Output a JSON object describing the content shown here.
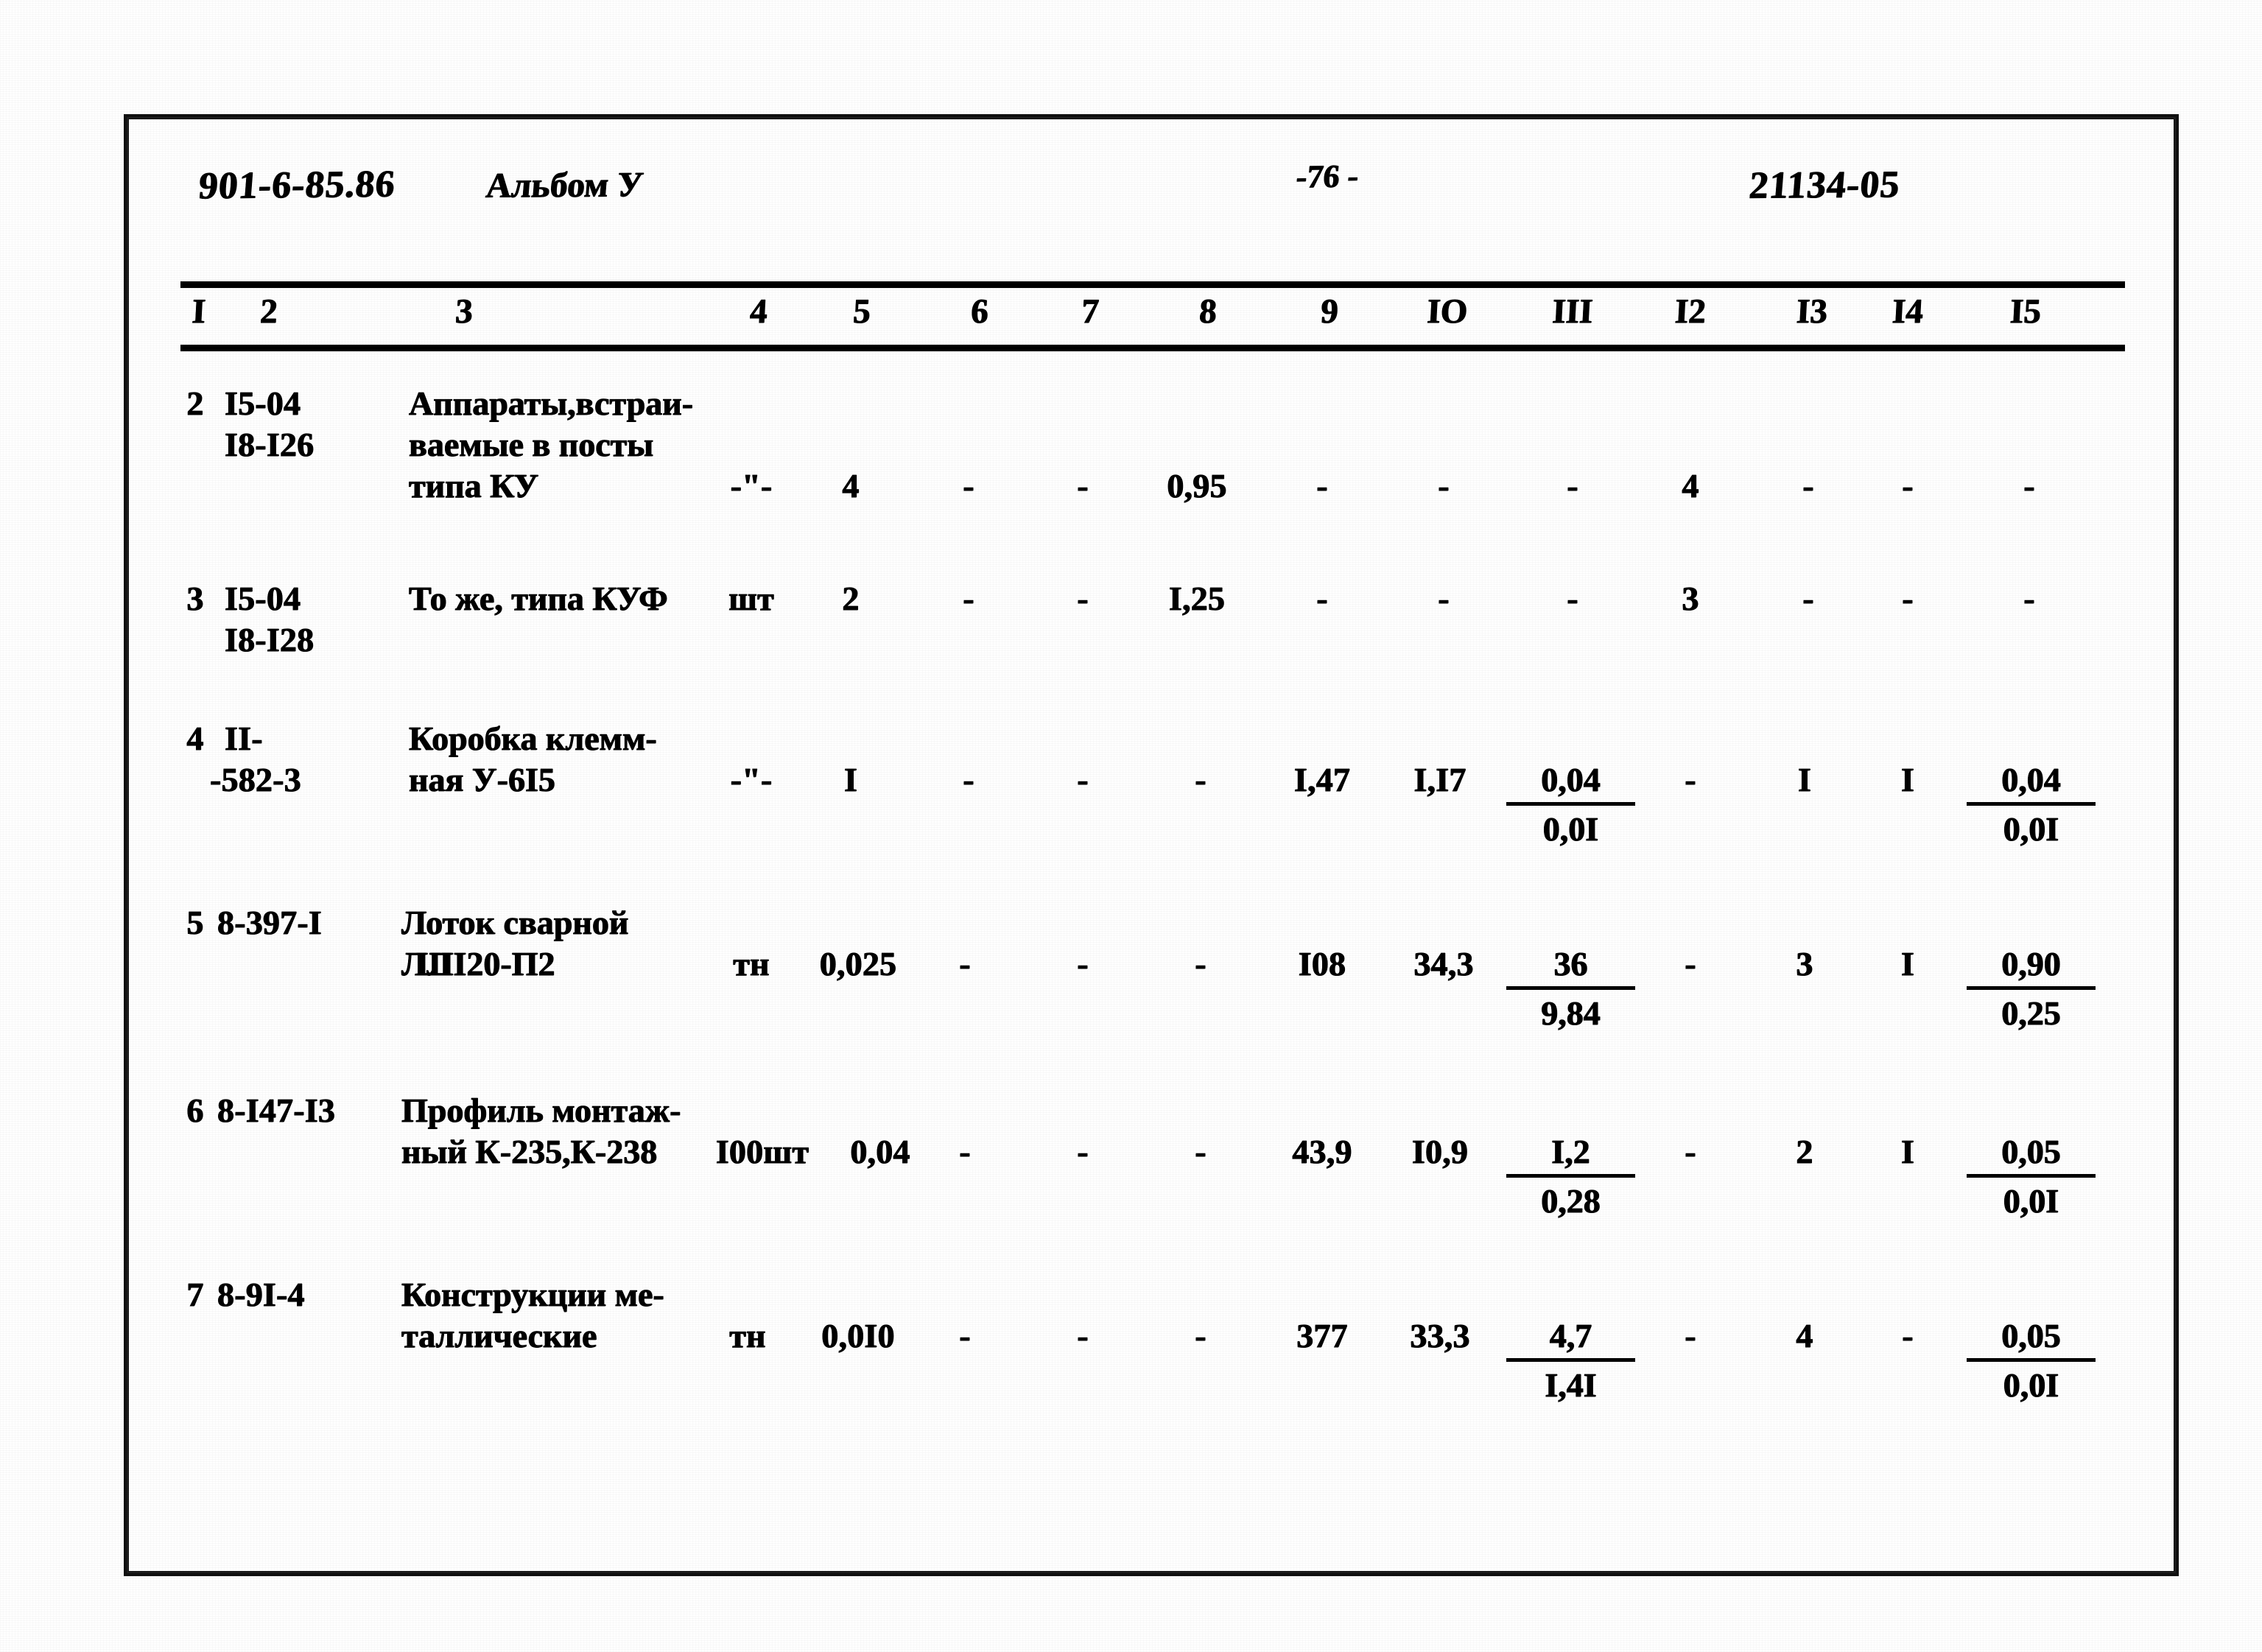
{
  "header": {
    "doc_code": "901-6-85.86",
    "album": "Альбом У",
    "page_number": "-76 -",
    "right_code": "21134-05"
  },
  "table": {
    "column_numbers": [
      "I",
      "2",
      "3",
      "4",
      "5",
      "6",
      "7",
      "8",
      "9",
      "IO",
      "III",
      "I2",
      "I3",
      "I4",
      "I5"
    ],
    "rows": [
      {
        "c1": "2",
        "c2_line1": "I5-04",
        "c2_line2": "I8-I26",
        "c3_line1": "Аппараты,встраи-",
        "c3_line2": "ваемые в посты",
        "c3_line3": "типа КУ",
        "c4": "-\"-",
        "c5": "4",
        "c6": "-",
        "c7": "-",
        "c8": "0,95",
        "c9": "-",
        "c10": "-",
        "c11": "-",
        "c12": "4",
        "c13": "-",
        "c14": "-",
        "c15": "-"
      },
      {
        "c1": "3",
        "c2_line1": "I5-04",
        "c2_line2": "I8-I28",
        "c3_line1": "То же, типа КУФ",
        "c3_line2": "",
        "c3_line3": "",
        "c4": "шт",
        "c5": "2",
        "c6": "-",
        "c7": "-",
        "c8": "I,25",
        "c9": "-",
        "c10": "-",
        "c11": "-",
        "c12": "3",
        "c13": "-",
        "c14": "-",
        "c15": "-"
      },
      {
        "c1": "4",
        "c2_line1": "II-",
        "c2_line2": "-582-3",
        "c3_line1": "Коробка клемм-",
        "c3_line2": "ная У-6I5",
        "c3_line3": "",
        "c4": "-\"-",
        "c5": "I",
        "c6": "-",
        "c7": "-",
        "c8": "-",
        "c9": "I,47",
        "c10": "I,I7",
        "c11_top": "0,04",
        "c11_bot": "0,0I",
        "c12": "-",
        "c13": "I",
        "c14": "I",
        "c15_top": "0,04",
        "c15_bot": "0,0I"
      },
      {
        "c1": "5",
        "c2_line1": "8-397-I",
        "c2_line2": "",
        "c3_line1": "Лоток сварной",
        "c3_line2": "ШI20-П2",
        "c3_line2_overstrike": "ЛЛ",
        "c3_line3": "",
        "c4": "тн",
        "c5": "0,025",
        "c6": "-",
        "c7": "-",
        "c8": "-",
        "c9": "I08",
        "c10": "34,3",
        "c11_top": "36",
        "c11_bot": "9,84",
        "c12": "-",
        "c13": "3",
        "c14": "I",
        "c15_top": "0,90",
        "c15_bot": "0,25"
      },
      {
        "c1": "6",
        "c2_line1": "8-I47-I3",
        "c2_line2": "",
        "c3_line1": "Профиль монтаж-",
        "c3_line2": "ный К-235,К-238",
        "c3_line3": "",
        "c4": "I00шт",
        "c5": "0,04",
        "c6": "-",
        "c7": "-",
        "c8": "-",
        "c9": "43,9",
        "c10": "I0,9",
        "c11_top": "I,2",
        "c11_bot": "0,28",
        "c12": "-",
        "c13": "2",
        "c14": "I",
        "c15_top": "0,05",
        "c15_bot": "0,0I"
      },
      {
        "c1": "7",
        "c2_line1": "8-9I-4",
        "c2_line2": "",
        "c3_line1": "Конструкции ме-",
        "c3_line2": "таллические",
        "c3_line3": "",
        "c4": "тн",
        "c5": "0,0I0",
        "c6": "-",
        "c7": "-",
        "c8": "-",
        "c9": "377",
        "c10": "33,3",
        "c11_top": "4,7",
        "c11_bot": "I,4I",
        "c12": "-",
        "c13": "4",
        "c14": "-",
        "c15_top": "0,05",
        "c15_bot": "0,0I"
      }
    ]
  },
  "colors": {
    "ink": "#000000",
    "paper": "#ffffff"
  }
}
